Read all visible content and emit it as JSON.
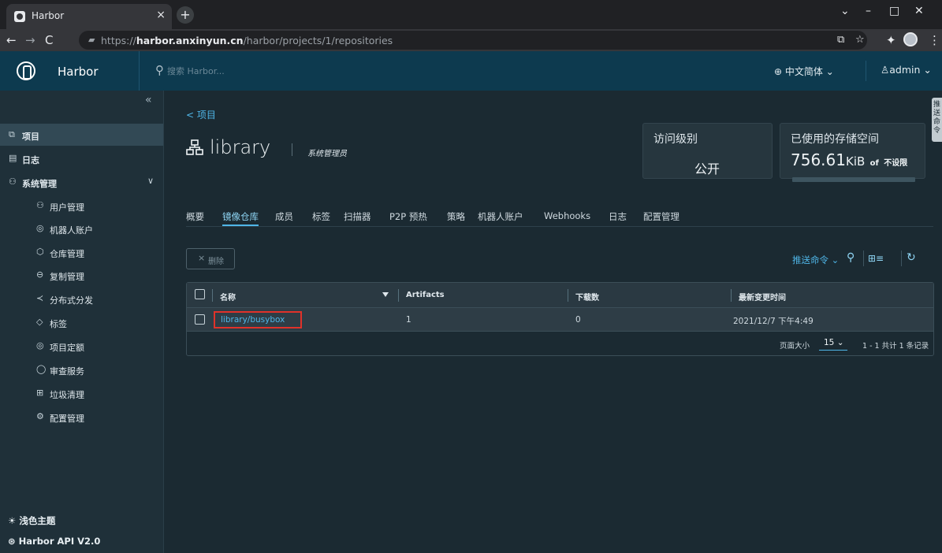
{
  "browser": {
    "tab_title": "Harbor",
    "tab_close": "×",
    "new_tab": "+",
    "url_scheme": "https://",
    "url_host": "harbor.anxinyun.cn",
    "url_path": "/harbor/projects/1/repositories",
    "window_controls": [
      "⌄",
      "–",
      "□",
      "✕"
    ]
  },
  "header": {
    "brand": "Harbor",
    "search_placeholder": "搜索 Harbor...",
    "language": "中文简体",
    "user": "admin"
  },
  "sidebar": {
    "items": [
      {
        "label": "项目",
        "icon": "projects-icon",
        "glyph": "⧉"
      },
      {
        "label": "日志",
        "icon": "logs-icon",
        "glyph": "▤"
      },
      {
        "label": "系统管理",
        "icon": "admin-icon",
        "glyph": "⚇"
      }
    ],
    "sub_items": [
      {
        "label": "用户管理",
        "icon": "users-icon",
        "glyph": "⚇"
      },
      {
        "label": "机器人账户",
        "icon": "robot-icon",
        "glyph": "◎"
      },
      {
        "label": "仓库管理",
        "icon": "registry-icon",
        "glyph": "⬡"
      },
      {
        "label": "复制管理",
        "icon": "replication-icon",
        "glyph": "⊖"
      },
      {
        "label": "分布式分发",
        "icon": "share-icon",
        "glyph": "≺"
      },
      {
        "label": "标签",
        "icon": "tag-icon",
        "glyph": "◇"
      },
      {
        "label": "项目定额",
        "icon": "quota-icon",
        "glyph": "◎"
      },
      {
        "label": "审查服务",
        "icon": "shield-icon",
        "glyph": "◯"
      },
      {
        "label": "垃圾清理",
        "icon": "trash-icon",
        "glyph": "⊞"
      },
      {
        "label": "配置管理",
        "icon": "settings-icon",
        "glyph": "⚙"
      }
    ],
    "theme_label": "浅色主题",
    "api_label": "Harbor API V2.0"
  },
  "project": {
    "back_label": "< 项目",
    "name": "library",
    "role": "系统管理员",
    "access_title": "访问级别",
    "access_value": "公开",
    "storage_title": "已使用的存储空间",
    "storage_value": "756.61",
    "storage_unit": "KiB",
    "storage_of": "of",
    "storage_limit": "不设限",
    "side_tab": "推送命令"
  },
  "tabs": [
    "概要",
    "镜像仓库",
    "成员",
    "标签",
    "扫描器",
    "P2P 预热",
    "策略",
    "机器人账户",
    "Webhooks",
    "日志",
    "配置管理"
  ],
  "toolbar": {
    "delete_label": "删除",
    "push_command": "推送命令"
  },
  "table": {
    "headers": [
      "名称",
      "Artifacts",
      "下载数",
      "最新变更时间"
    ],
    "rows": [
      {
        "name": "library/busybox",
        "artifacts": "1",
        "downloads": "0",
        "updated": "2021/12/7 下午4:49"
      }
    ],
    "page_size_label": "页面大小",
    "page_size": "15",
    "summary": "1 - 1 共计 1 条记录"
  },
  "colors": {
    "accent": "#4fb6e8",
    "header_bg": "#0d3a4f",
    "highlight_border": "#e0322a"
  }
}
